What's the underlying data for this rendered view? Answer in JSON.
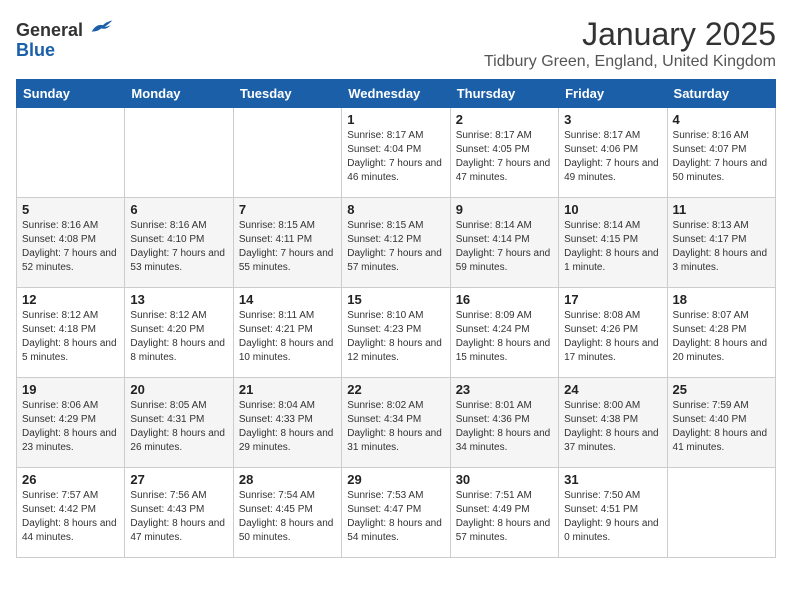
{
  "logo": {
    "general": "General",
    "blue": "Blue"
  },
  "title": "January 2025",
  "location": "Tidbury Green, England, United Kingdom",
  "days_of_week": [
    "Sunday",
    "Monday",
    "Tuesday",
    "Wednesday",
    "Thursday",
    "Friday",
    "Saturday"
  ],
  "weeks": [
    [
      {
        "day": "",
        "info": ""
      },
      {
        "day": "",
        "info": ""
      },
      {
        "day": "",
        "info": ""
      },
      {
        "day": "1",
        "info": "Sunrise: 8:17 AM\nSunset: 4:04 PM\nDaylight: 7 hours and 46 minutes."
      },
      {
        "day": "2",
        "info": "Sunrise: 8:17 AM\nSunset: 4:05 PM\nDaylight: 7 hours and 47 minutes."
      },
      {
        "day": "3",
        "info": "Sunrise: 8:17 AM\nSunset: 4:06 PM\nDaylight: 7 hours and 49 minutes."
      },
      {
        "day": "4",
        "info": "Sunrise: 8:16 AM\nSunset: 4:07 PM\nDaylight: 7 hours and 50 minutes."
      }
    ],
    [
      {
        "day": "5",
        "info": "Sunrise: 8:16 AM\nSunset: 4:08 PM\nDaylight: 7 hours and 52 minutes."
      },
      {
        "day": "6",
        "info": "Sunrise: 8:16 AM\nSunset: 4:10 PM\nDaylight: 7 hours and 53 minutes."
      },
      {
        "day": "7",
        "info": "Sunrise: 8:15 AM\nSunset: 4:11 PM\nDaylight: 7 hours and 55 minutes."
      },
      {
        "day": "8",
        "info": "Sunrise: 8:15 AM\nSunset: 4:12 PM\nDaylight: 7 hours and 57 minutes."
      },
      {
        "day": "9",
        "info": "Sunrise: 8:14 AM\nSunset: 4:14 PM\nDaylight: 7 hours and 59 minutes."
      },
      {
        "day": "10",
        "info": "Sunrise: 8:14 AM\nSunset: 4:15 PM\nDaylight: 8 hours and 1 minute."
      },
      {
        "day": "11",
        "info": "Sunrise: 8:13 AM\nSunset: 4:17 PM\nDaylight: 8 hours and 3 minutes."
      }
    ],
    [
      {
        "day": "12",
        "info": "Sunrise: 8:12 AM\nSunset: 4:18 PM\nDaylight: 8 hours and 5 minutes."
      },
      {
        "day": "13",
        "info": "Sunrise: 8:12 AM\nSunset: 4:20 PM\nDaylight: 8 hours and 8 minutes."
      },
      {
        "day": "14",
        "info": "Sunrise: 8:11 AM\nSunset: 4:21 PM\nDaylight: 8 hours and 10 minutes."
      },
      {
        "day": "15",
        "info": "Sunrise: 8:10 AM\nSunset: 4:23 PM\nDaylight: 8 hours and 12 minutes."
      },
      {
        "day": "16",
        "info": "Sunrise: 8:09 AM\nSunset: 4:24 PM\nDaylight: 8 hours and 15 minutes."
      },
      {
        "day": "17",
        "info": "Sunrise: 8:08 AM\nSunset: 4:26 PM\nDaylight: 8 hours and 17 minutes."
      },
      {
        "day": "18",
        "info": "Sunrise: 8:07 AM\nSunset: 4:28 PM\nDaylight: 8 hours and 20 minutes."
      }
    ],
    [
      {
        "day": "19",
        "info": "Sunrise: 8:06 AM\nSunset: 4:29 PM\nDaylight: 8 hours and 23 minutes."
      },
      {
        "day": "20",
        "info": "Sunrise: 8:05 AM\nSunset: 4:31 PM\nDaylight: 8 hours and 26 minutes."
      },
      {
        "day": "21",
        "info": "Sunrise: 8:04 AM\nSunset: 4:33 PM\nDaylight: 8 hours and 29 minutes."
      },
      {
        "day": "22",
        "info": "Sunrise: 8:02 AM\nSunset: 4:34 PM\nDaylight: 8 hours and 31 minutes."
      },
      {
        "day": "23",
        "info": "Sunrise: 8:01 AM\nSunset: 4:36 PM\nDaylight: 8 hours and 34 minutes."
      },
      {
        "day": "24",
        "info": "Sunrise: 8:00 AM\nSunset: 4:38 PM\nDaylight: 8 hours and 37 minutes."
      },
      {
        "day": "25",
        "info": "Sunrise: 7:59 AM\nSunset: 4:40 PM\nDaylight: 8 hours and 41 minutes."
      }
    ],
    [
      {
        "day": "26",
        "info": "Sunrise: 7:57 AM\nSunset: 4:42 PM\nDaylight: 8 hours and 44 minutes."
      },
      {
        "day": "27",
        "info": "Sunrise: 7:56 AM\nSunset: 4:43 PM\nDaylight: 8 hours and 47 minutes."
      },
      {
        "day": "28",
        "info": "Sunrise: 7:54 AM\nSunset: 4:45 PM\nDaylight: 8 hours and 50 minutes."
      },
      {
        "day": "29",
        "info": "Sunrise: 7:53 AM\nSunset: 4:47 PM\nDaylight: 8 hours and 54 minutes."
      },
      {
        "day": "30",
        "info": "Sunrise: 7:51 AM\nSunset: 4:49 PM\nDaylight: 8 hours and 57 minutes."
      },
      {
        "day": "31",
        "info": "Sunrise: 7:50 AM\nSunset: 4:51 PM\nDaylight: 9 hours and 0 minutes."
      },
      {
        "day": "",
        "info": ""
      }
    ]
  ]
}
